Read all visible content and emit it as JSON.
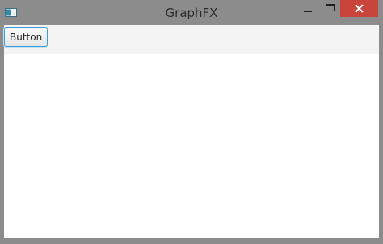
{
  "window": {
    "title": "GraphFX",
    "close_color": "#c9443b"
  },
  "toolbar": {
    "button_label": "Button"
  },
  "icons": {
    "app": "app-window-icon",
    "minimize": "minimize-icon",
    "maximize": "maximize-icon",
    "close": "close-icon"
  }
}
